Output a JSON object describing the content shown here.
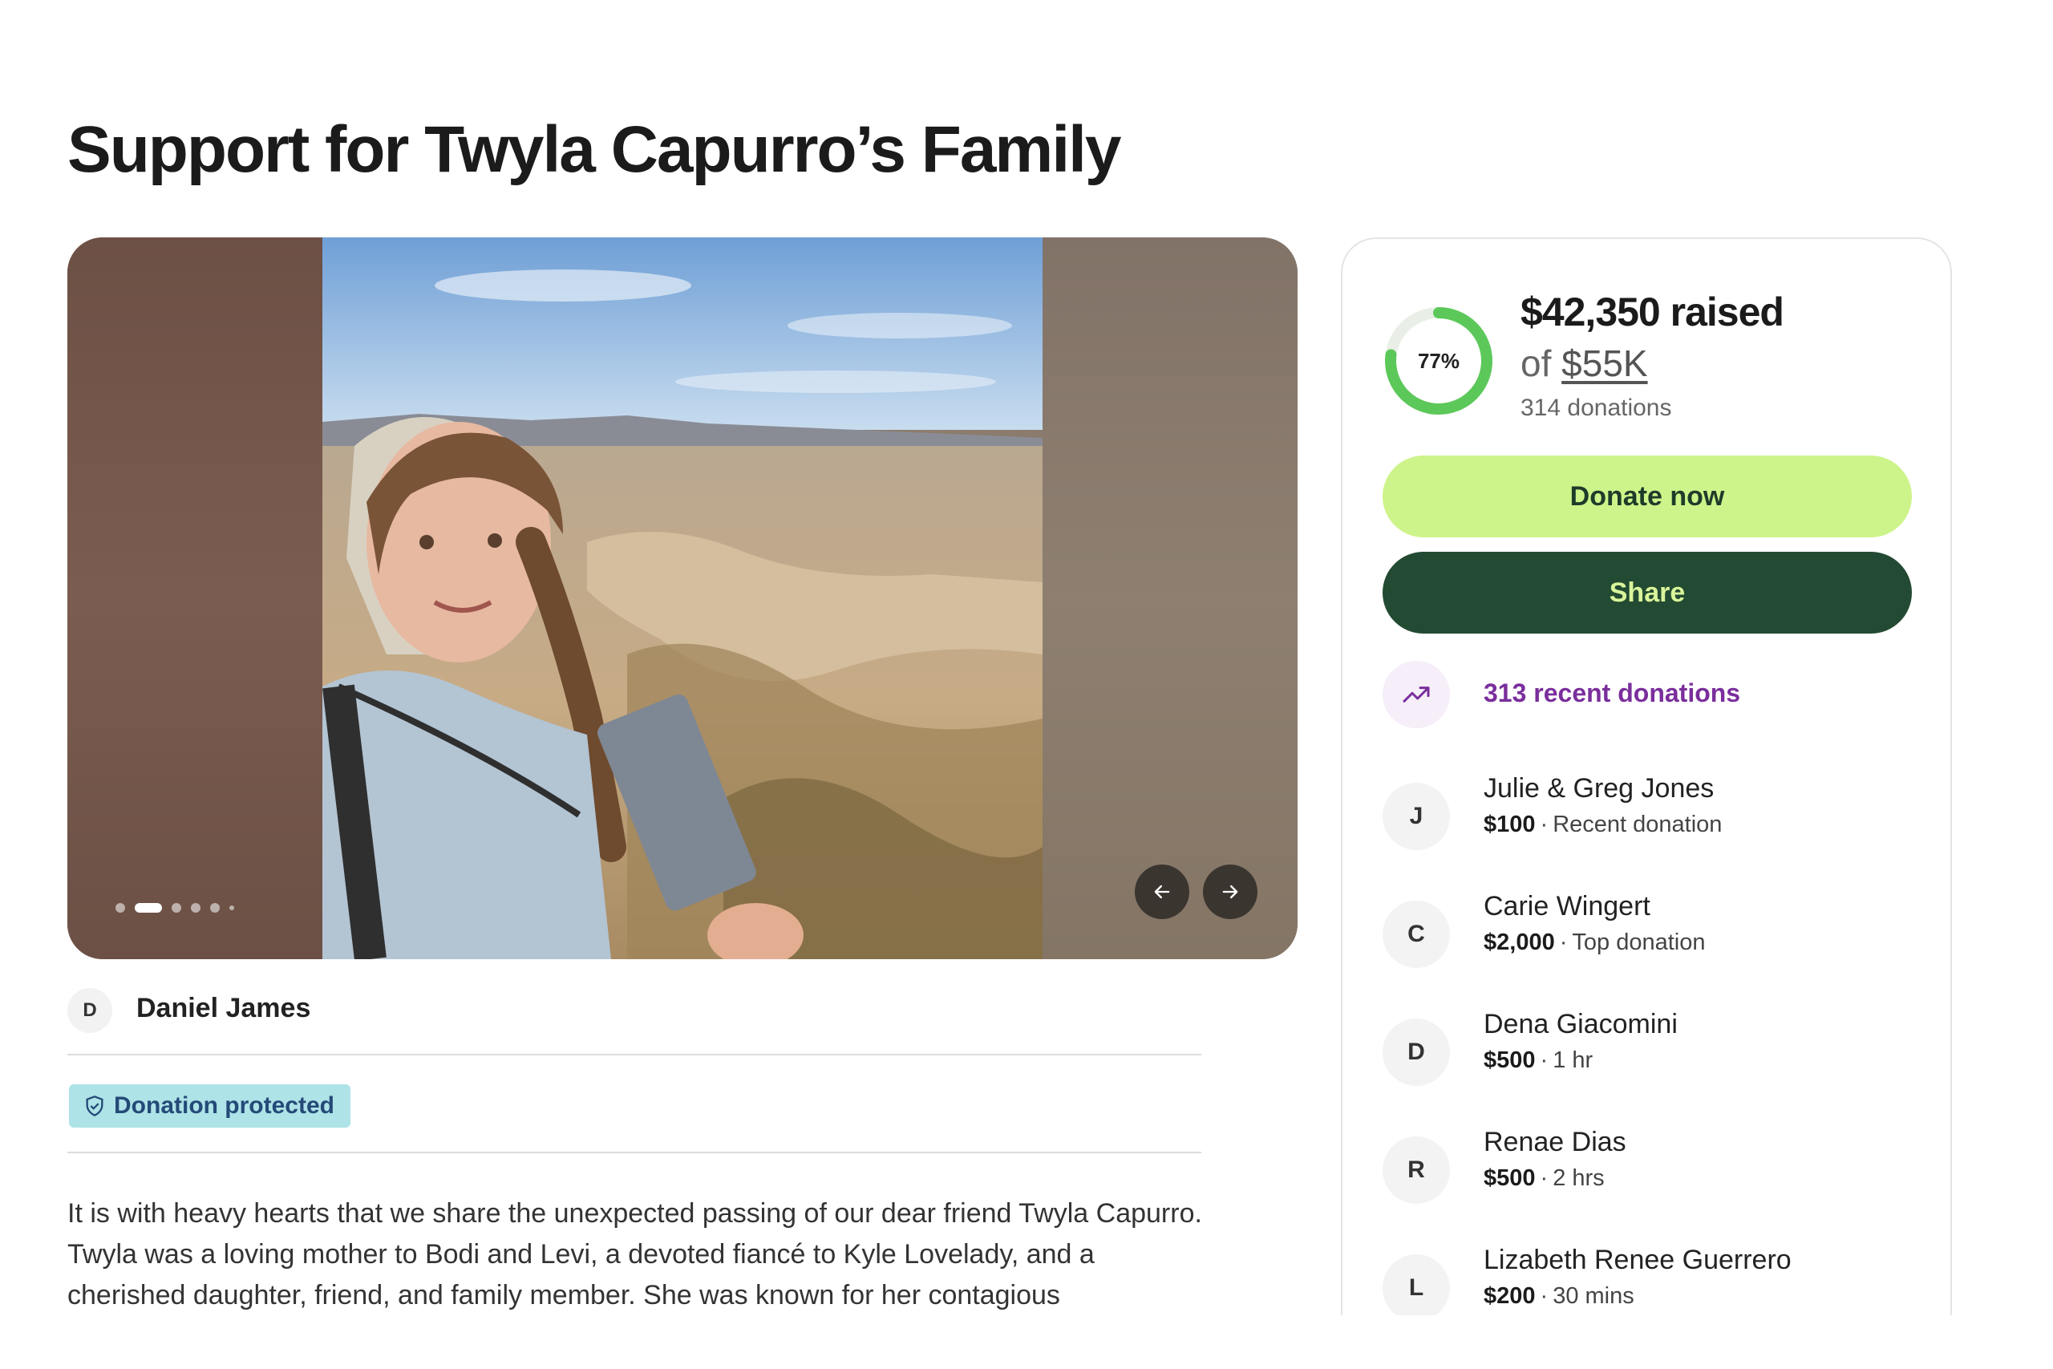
{
  "campaign": {
    "title": "Support for Twyla Capurro’s Family"
  },
  "carousel": {
    "slide_count": 5,
    "active_slide": 2,
    "prev_icon": "arrow-left-icon",
    "next_icon": "arrow-right-icon"
  },
  "organizer": {
    "initial": "D",
    "name": "Daniel James"
  },
  "badge": {
    "icon": "shield-icon",
    "label": "Donation protected"
  },
  "story": {
    "text": "It is with heavy hearts that we share the unexpected passing of our dear friend Twyla Capurro. Twyla was a loving mother to Bodi and Levi, a devoted fiancé to Kyle Lovelady, and a cherished daughter, friend, and family member. She was known for her contagious"
  },
  "progress": {
    "percent_label": "77%",
    "percent_value": 0.77,
    "raised": "$42,350 raised",
    "goal_prefix": "of",
    "goal_amount": "$55K",
    "donations": "314 donations"
  },
  "buttons": {
    "donate": "Donate now",
    "share": "Share"
  },
  "recent": {
    "icon": "trending-up-icon",
    "label": "313 recent donations"
  },
  "donors": [
    {
      "initial": "J",
      "name": "Julie & Greg Jones",
      "amount": "$100",
      "note": "Recent donation"
    },
    {
      "initial": "C",
      "name": "Carie Wingert",
      "amount": "$2,000",
      "note": "Top donation"
    },
    {
      "initial": "D",
      "name": "Dena Giacomini",
      "amount": "$500",
      "note": "1 hr"
    },
    {
      "initial": "R",
      "name": "Renae Dias",
      "amount": "$500",
      "note": "2 hrs"
    },
    {
      "initial": "L",
      "name": "Lizabeth Renee Guerrero",
      "amount": "$200",
      "note": "30 mins"
    }
  ],
  "colors": {
    "donate_button": "#cdf48a",
    "share_button": "#234a32",
    "progress_ring": "#5cc85a",
    "recent_accent": "#7a2e9c",
    "badge_bg": "#aee3e7"
  }
}
